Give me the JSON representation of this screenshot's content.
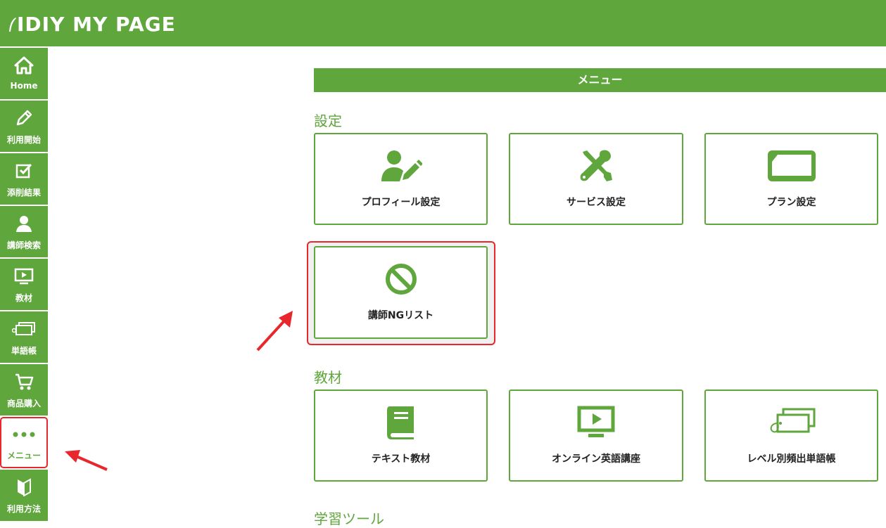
{
  "header": {
    "logo_text": "IDIY",
    "title": "MY PAGE"
  },
  "sidebar": {
    "items": [
      {
        "label": "Home",
        "icon": "home-icon"
      },
      {
        "label": "利用開始",
        "icon": "pencil-icon"
      },
      {
        "label": "添削結果",
        "icon": "checkbox-icon"
      },
      {
        "label": "講師検索",
        "icon": "person-icon"
      },
      {
        "label": "教材",
        "icon": "monitor-play-icon"
      },
      {
        "label": "単語帳",
        "icon": "tag-icon"
      },
      {
        "label": "商品購入",
        "icon": "cart-icon"
      },
      {
        "label": "メニュー",
        "icon": "dots-icon"
      },
      {
        "label": "利用方法",
        "icon": "beginner-mark-icon"
      }
    ]
  },
  "main": {
    "menu_title": "メニュー",
    "sections": [
      {
        "title": "設定",
        "cards": [
          {
            "label": "プロフィール設定",
            "icon": "user-edit-icon"
          },
          {
            "label": "サービス設定",
            "icon": "tools-icon"
          },
          {
            "label": "プラン設定",
            "icon": "card-icon"
          },
          {
            "label": "講師NGリスト",
            "icon": "ban-icon"
          }
        ]
      },
      {
        "title": "教材",
        "cards": [
          {
            "label": "テキスト教材",
            "icon": "book-icon"
          },
          {
            "label": "オンライン英語講座",
            "icon": "video-icon"
          },
          {
            "label": "レベル別頻出単語帳",
            "icon": "tag-icon"
          }
        ]
      },
      {
        "title": "学習ツール",
        "cards": []
      }
    ]
  },
  "colors": {
    "brand": "#5fa63c",
    "highlight": "#e8262b"
  }
}
